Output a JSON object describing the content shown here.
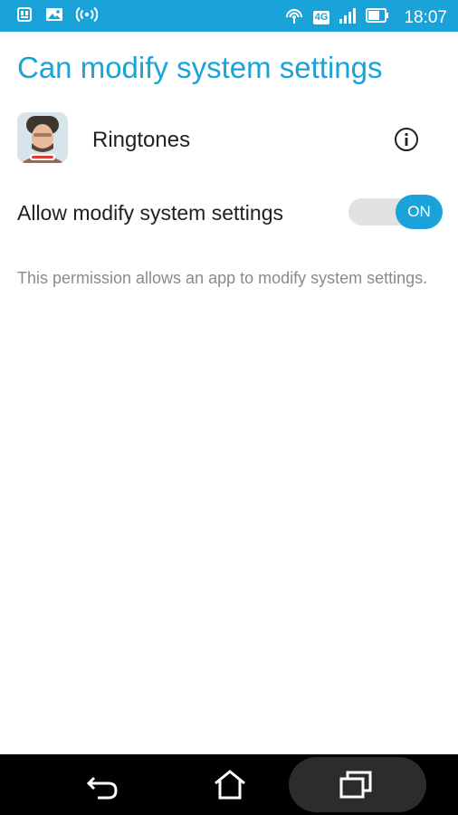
{
  "status_bar": {
    "time": "18:07",
    "network_badge": "4G",
    "left_icons": [
      "sim-icon",
      "image-icon",
      "hotspot-icon"
    ],
    "right_icons": [
      "wireless-icon",
      "network-4g-icon",
      "signal-icon",
      "battery-icon"
    ]
  },
  "page": {
    "title": "Can modify system settings"
  },
  "app": {
    "name": "Ringtones",
    "icon": "app-avatar-icon"
  },
  "permission": {
    "label": "Allow modify system settings",
    "toggle_state": "ON",
    "description": "This permission allows an app to modify system settings."
  },
  "nav_bar": {
    "buttons": [
      "back-icon",
      "home-icon",
      "recent-apps-icon"
    ]
  },
  "colors": {
    "accent": "#1aa3d9",
    "status_bar": "#1aa3d9",
    "nav_bar": "#000000",
    "text_primary": "#212121",
    "text_secondary": "#8a8a8a"
  }
}
